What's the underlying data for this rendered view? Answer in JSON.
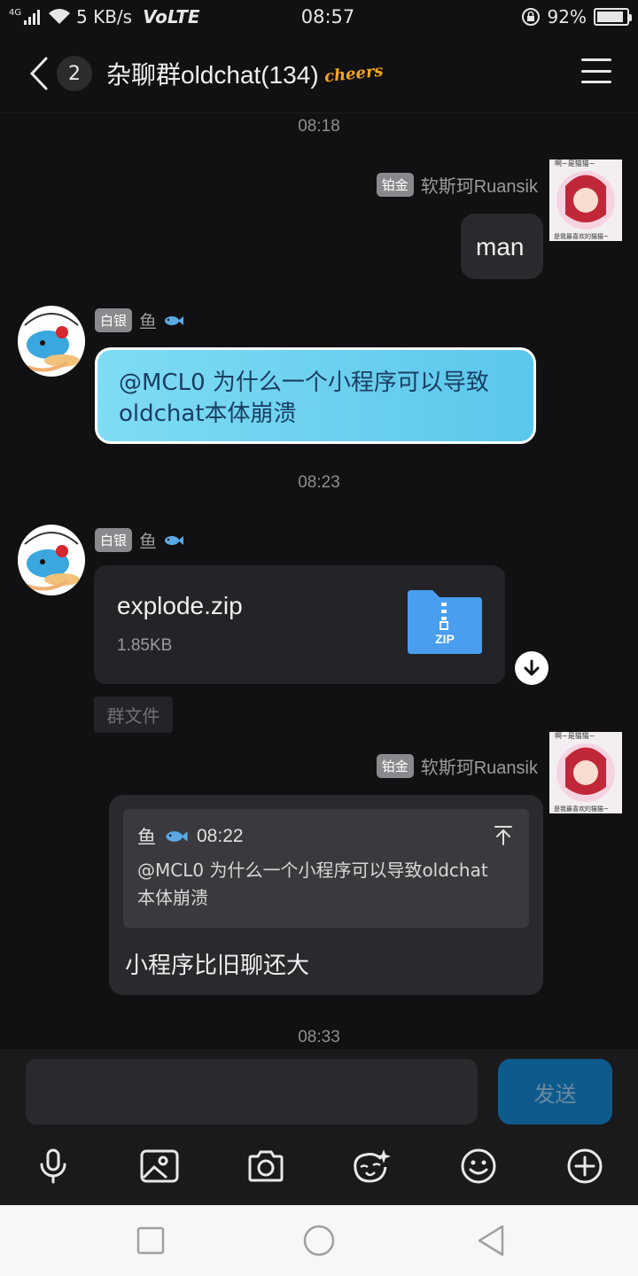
{
  "status_bar": {
    "network_type": "4G",
    "speed": "5 KB/s",
    "volte": "VoLTE",
    "time": "08:57",
    "battery": "92%",
    "battery_level": 0.92
  },
  "header": {
    "unread_count": "2",
    "title": "杂聊群oldchat(134)",
    "badge": "cheers"
  },
  "messages": {
    "ts1": "08:18",
    "msg1": {
      "rank": "铂金",
      "name": "软斯珂Ruansik",
      "text": "man"
    },
    "msg2": {
      "rank": "白银",
      "name": "鱼",
      "text": "@MCL0 为什么一个小程序可以导致oldchat本体崩溃"
    },
    "ts2": "08:23",
    "msg3": {
      "rank": "白银",
      "name": "鱼",
      "file_name": "explode.zip",
      "file_size": "1.85KB",
      "file_tag": "群文件",
      "zip_label": "ZIP"
    },
    "msg4": {
      "rank": "铂金",
      "name": "软斯珂Ruansik",
      "quote_name": "鱼",
      "quote_time": "08:22",
      "quote_text": "@MCL0 为什么一个小程序可以导致oldchat本体崩溃",
      "text": "小程序比旧聊还大"
    },
    "ts3": "08:33"
  },
  "avatar_text": {
    "top": "啊~是猫猫~",
    "bottom": "是我最喜欢的猫猫~"
  },
  "input": {
    "placeholder": "",
    "send_label": "发送"
  },
  "toolbar": [
    "mic-icon",
    "image-icon",
    "camera-icon",
    "sticker-icon",
    "emoji-icon",
    "plus-icon"
  ],
  "colors": {
    "background": "#111113",
    "bubble_dark": "#2a2a2e",
    "bubble_blue": "#5ac7ec",
    "send_button": "#0e5a8c",
    "zip_blue": "#4a9ef0"
  }
}
